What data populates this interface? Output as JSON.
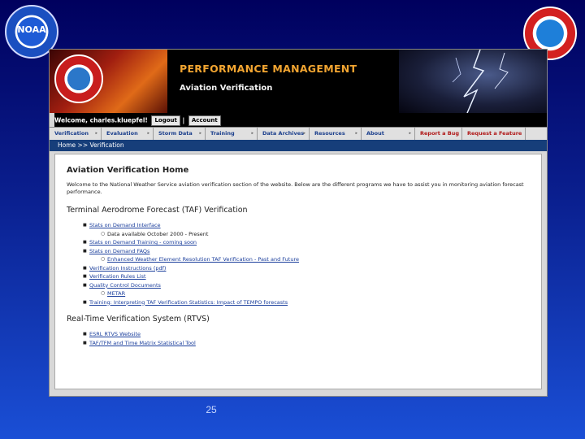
{
  "logos": {
    "noaa": "NOAA"
  },
  "header": {
    "title": "PERFORMANCE MANAGEMENT",
    "subtitle": "Aviation Verification",
    "welcome": "Welcome, charles.kluepfel!",
    "logout": "Logout",
    "separator": "|",
    "account": "Account"
  },
  "nav": {
    "items": [
      {
        "label": "Verification",
        "arrow": "▸"
      },
      {
        "label": "Evaluation",
        "arrow": "▸"
      },
      {
        "label": "Storm Data",
        "arrow": "▸"
      },
      {
        "label": "Training",
        "arrow": "▸"
      },
      {
        "label": "Data Archives",
        "arrow": "▸"
      },
      {
        "label": "Resources",
        "arrow": "▸"
      },
      {
        "label": "About",
        "arrow": "▸"
      },
      {
        "label": "Report a Bug"
      },
      {
        "label": "Request a Feature"
      }
    ]
  },
  "breadcrumb": "Home >> Verification",
  "content": {
    "heading": "Aviation Verification Home",
    "intro": "Welcome to the National Weather Service aviation verification section of the website. Below are the different programs we have to assist you in monitoring aviation forecast performance.",
    "taf": {
      "title": "Terminal Aerodrome Forecast (TAF) Verification",
      "items": [
        {
          "text": "Stats on Demand Interface",
          "sub": [
            "Data available October 2000 - Present"
          ]
        },
        {
          "text": "Stats on Demand Training - coming soon"
        },
        {
          "text": "Stats on Demand FAQs",
          "sub": [
            "Enhanced Weather Element Resolution TAF Verification - Past and Future"
          ]
        },
        {
          "text": "Verification Instructions (pdf)",
          "link": true
        },
        {
          "text": "Verification Rules List",
          "link": true
        },
        {
          "text": "Quality Control Documents",
          "sub": [
            "METAR"
          ],
          "sublink": true
        },
        {
          "text": "Training: Interpreting TAF Verification Statistics: Impact of TEMPO forecasts",
          "link": true
        }
      ]
    },
    "rtvs": {
      "title": "Real-Time Verification System (RTVS)",
      "items": [
        {
          "text": "ESRL RTVS Website",
          "link": true
        },
        {
          "text": "TAF/TFM and Time Matrix Statistical Tool",
          "link": true
        }
      ]
    }
  },
  "slide_number": "25",
  "colors": {
    "accent_orange": "#f2a531",
    "nav_blue": "#1a3e8c",
    "breadcrumb_bg": "#163e7a"
  }
}
